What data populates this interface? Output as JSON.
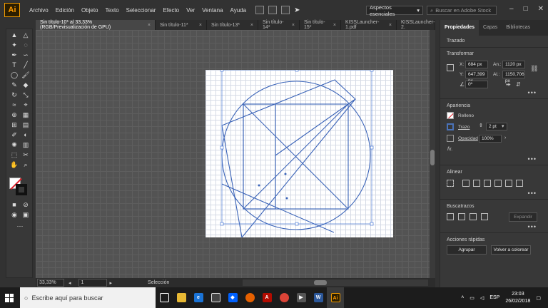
{
  "app": {
    "logo": "Ai"
  },
  "menu": [
    "Archivo",
    "Edición",
    "Objeto",
    "Texto",
    "Seleccionar",
    "Efecto",
    "Ver",
    "Ventana",
    "Ayuda"
  ],
  "workspace": "Aspectos esenciales",
  "stock_search_placeholder": "Buscar en Adobe Stock",
  "tabs": [
    {
      "label": "Sin título-10* al 33,33% (RGB/Previsualización de GPU)",
      "active": true
    },
    {
      "label": "Sin título-11*"
    },
    {
      "label": "Sin título-13*"
    },
    {
      "label": "Sin título-14*"
    },
    {
      "label": "Sin título-15*"
    },
    {
      "label": "KISSLauncher-1.pdf"
    },
    {
      "label": "KISSLauncher-2."
    }
  ],
  "status": {
    "zoom": "33,33%",
    "page": "1",
    "tool": "Selección"
  },
  "panel": {
    "tabs": [
      "Propiedades",
      "Capas",
      "Bibliotecas"
    ],
    "object_type": "Trazado",
    "transform": {
      "title": "Transformar",
      "x_label": "X:",
      "x": "684 px",
      "y_label": "Y:",
      "y": "647,399 px",
      "w_label": "An.:",
      "w": "1120 px",
      "h_label": "Al.:",
      "h": "1150,706 px",
      "angle": "0º"
    },
    "appearance": {
      "title": "Apariencia",
      "fill_label": "Relleno",
      "stroke_label": "Trazo",
      "stroke_weight": "2 pt",
      "opacity_label": "Opacidad",
      "opacity": "100%"
    },
    "align_title": "Alinear",
    "pathfinder_title": "Buscatrazos",
    "pathfinder_expand": "Expandir",
    "quick_actions": {
      "title": "Acciones rápidas",
      "group": "Agrupar",
      "recolor": "Volver a colorear"
    }
  },
  "taskbar": {
    "search_placeholder": "Escribe aquí para buscar",
    "language": "ESP",
    "time": "23:03",
    "date": "26/02/2018"
  },
  "colors": {
    "accent": "#ff9a00",
    "art_stroke": "#3b64b8",
    "selection": "#4a7bd6"
  }
}
